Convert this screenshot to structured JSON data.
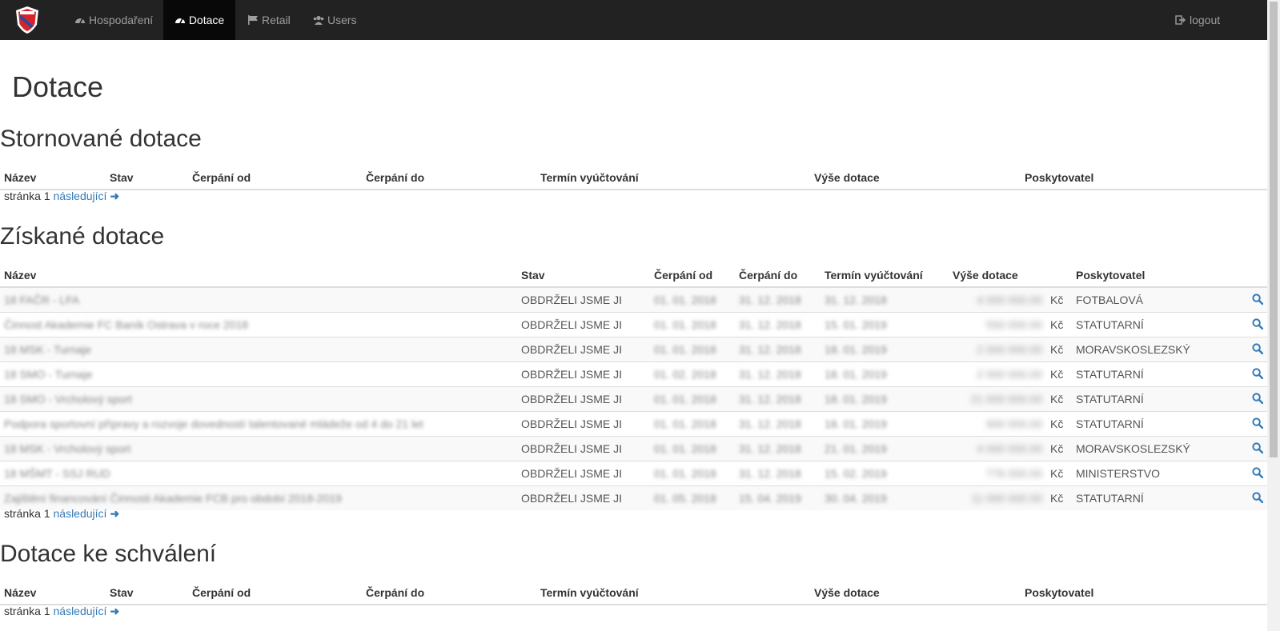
{
  "nav": {
    "items": [
      {
        "label": "Hospodaření",
        "icon": "dashboard-icon"
      },
      {
        "label": "Dotace",
        "icon": "dashboard-icon"
      },
      {
        "label": "Retail",
        "icon": "flag-icon"
      },
      {
        "label": "Users",
        "icon": "users-icon"
      }
    ],
    "logout": "logout"
  },
  "page_title": "Dotace",
  "columns": {
    "name": "Název",
    "status": "Stav",
    "from": "Čerpání od",
    "to": "Čerpání do",
    "settlement": "Termín vyúčtování",
    "amount": "Výše dotace",
    "provider": "Poskytovatel"
  },
  "pager": {
    "prefix": "stránka",
    "page": "1",
    "next": "následující"
  },
  "sections": {
    "cancelled": "Stornované dotace",
    "received": "Získané dotace",
    "pending": "Dotace ke schválení"
  },
  "rows": [
    {
      "name": "18 FAČR - LFA",
      "status": "OBDRŽELI JSME JI",
      "from": "01. 01. 2018",
      "to": "31. 12. 2018",
      "settlement": "31. 12. 2018",
      "amount": "4 000 000.00",
      "currency": "Kč",
      "provider": "FOTBALOVÁ"
    },
    {
      "name": "Činnost Akademie FC Baník Ostrava v roce 2018",
      "status": "OBDRŽELI JSME JI",
      "from": "01. 01. 2018",
      "to": "31. 12. 2018",
      "settlement": "15. 01. 2019",
      "amount": "550 000.00",
      "currency": "Kč",
      "provider": "STATUTARNÍ"
    },
    {
      "name": "18 MSK - Turnaje",
      "status": "OBDRŽELI JSME JI",
      "from": "01. 01. 2018",
      "to": "31. 12. 2018",
      "settlement": "18. 01. 2019",
      "amount": "2 000 000.00",
      "currency": "Kč",
      "provider": "MORAVSKOSLEZSKÝ"
    },
    {
      "name": "18 SMO - Turnaje",
      "status": "OBDRŽELI JSME JI",
      "from": "01. 02. 2018",
      "to": "31. 12. 2018",
      "settlement": "18. 01. 2019",
      "amount": "2 000 000.00",
      "currency": "Kč",
      "provider": "STATUTARNÍ"
    },
    {
      "name": "18 SMO - Vrcholový sport",
      "status": "OBDRŽELI JSME JI",
      "from": "01. 01. 2018",
      "to": "31. 12. 2018",
      "settlement": "18. 01. 2019",
      "amount": "21 000 000.00",
      "currency": "Kč",
      "provider": "STATUTARNÍ"
    },
    {
      "name": "Podpora sportovní přípravy a rozvoje dovedností talentované mládeže od 4 do 21 let",
      "status": "OBDRŽELI JSME JI",
      "from": "01. 01. 2018",
      "to": "31. 12. 2018",
      "settlement": "18. 01. 2019",
      "amount": "900 000.00",
      "currency": "Kč",
      "provider": "STATUTARNÍ"
    },
    {
      "name": "18 MSK - Vrcholový sport",
      "status": "OBDRŽELI JSME JI",
      "from": "01. 01. 2018",
      "to": "31. 12. 2018",
      "settlement": "21. 01. 2019",
      "amount": "4 000 000.00",
      "currency": "Kč",
      "provider": "MORAVSKOSLEZSKÝ"
    },
    {
      "name": "18 MŠMT - SSJ RUD",
      "status": "OBDRŽELI JSME JI",
      "from": "01. 01. 2018",
      "to": "31. 12. 2018",
      "settlement": "15. 02. 2019",
      "amount": "776 000.00",
      "currency": "Kč",
      "provider": "MINISTERSTVO"
    },
    {
      "name": "Zajištění financování Činnosti Akademie FCB pro období 2018-2019",
      "status": "OBDRŽELI JSME JI",
      "from": "01. 05. 2018",
      "to": "15. 04. 2019",
      "settlement": "30. 04. 2019",
      "amount": "11 000 000.00",
      "currency": "Kč",
      "provider": "STATUTARNÍ"
    }
  ]
}
